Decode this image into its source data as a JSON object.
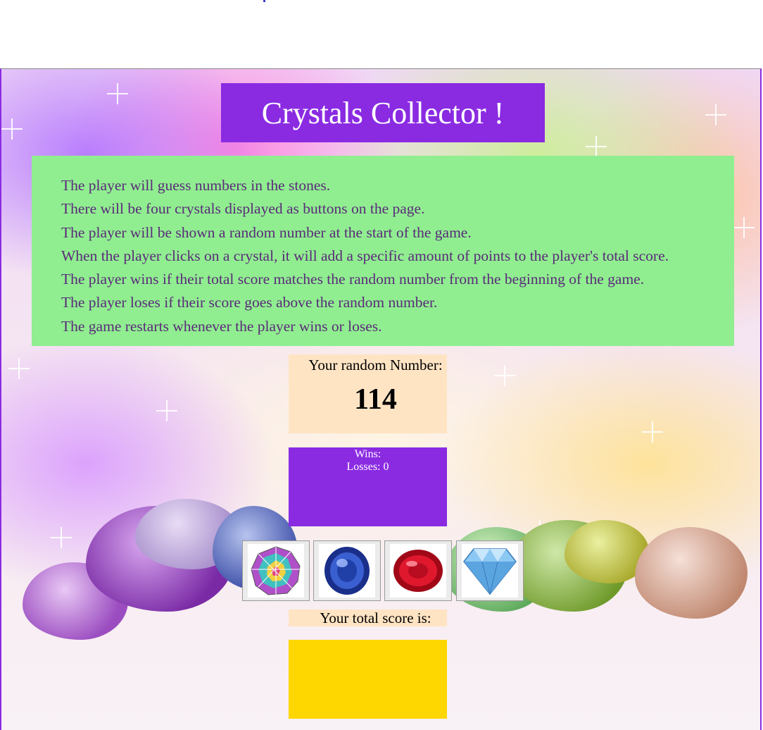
{
  "game": {
    "title": "Crystals Collector !",
    "rules": [
      "The player will guess numbers in the stones.",
      "There will be four crystals displayed as buttons on the page.",
      "The player will be shown a random number at the start of the game.",
      "When the player clicks on a crystal, it will add a specific amount of points to the player's total score.",
      "The player wins if their total score matches the random number from the beginning of the game.",
      "The player loses if their score goes above the random number.",
      "The game restarts whenever the player wins or loses."
    ],
    "random_label": "Your random Number:",
    "random_number": "114",
    "wins_label": "Wins:",
    "losses_label": "Losses: 0",
    "crystals": [
      {
        "name": "rainbow-crystal",
        "color": "#c050d0"
      },
      {
        "name": "sapphire-crystal",
        "color": "#1f3fa8"
      },
      {
        "name": "ruby-crystal",
        "color": "#d0102a"
      },
      {
        "name": "diamond-crystal",
        "color": "#6fb8ee"
      }
    ],
    "score_label": "Your total score is:",
    "total_score": ""
  },
  "colors": {
    "accent": "#8a2be2",
    "rules_bg": "#90ee90",
    "panel_bg": "#ffe4c4",
    "score_bg": "#ffd700"
  }
}
